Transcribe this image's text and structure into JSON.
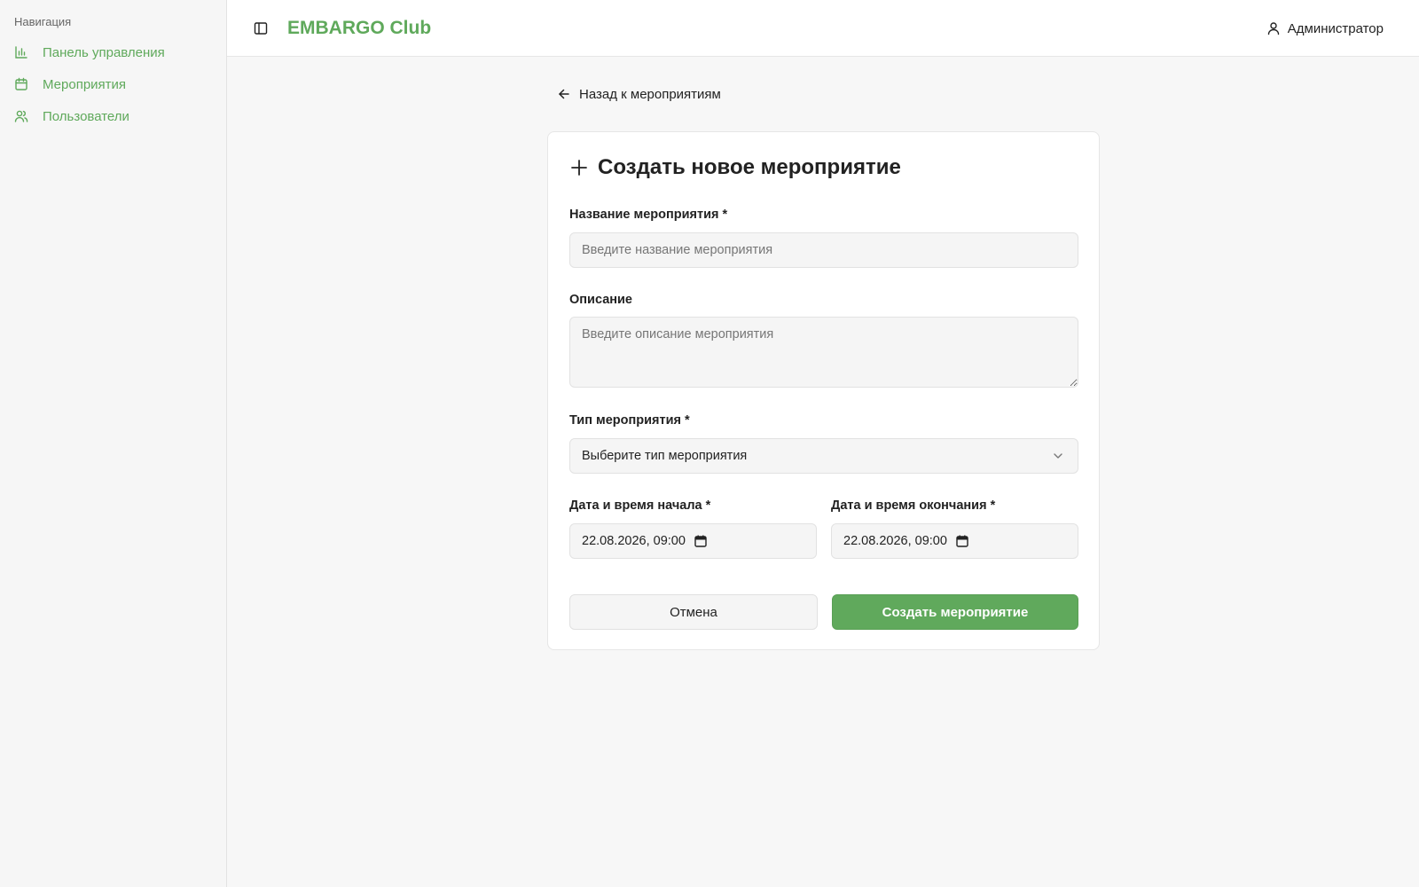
{
  "sidebar": {
    "section_title": "Навигация",
    "items": [
      {
        "label": "Панель управления",
        "icon": "bar-chart-icon"
      },
      {
        "label": "Мероприятия",
        "icon": "calendar-icon"
      },
      {
        "label": "Пользователи",
        "icon": "users-icon"
      }
    ]
  },
  "header": {
    "brand": "EMBARGO Club",
    "user_label": "Администратор"
  },
  "back_link": "Назад к мероприятиям",
  "form": {
    "title": "Создать новое мероприятие",
    "name_label": "Название мероприятия *",
    "name_placeholder": "Введите название мероприятия",
    "description_label": "Описание",
    "description_placeholder": "Введите описание мероприятия",
    "type_label": "Тип мероприятия *",
    "type_value": "Выберите тип мероприятия",
    "start_label": "Дата и время начала *",
    "start_value": "22.08.2026, 09:00",
    "end_label": "Дата и время окончания *",
    "end_value": "22.08.2026, 09:00",
    "cancel_label": "Отмена",
    "submit_label": "Создать мероприятие"
  },
  "colors": {
    "accent": "#5fa95b",
    "primary_button": "#60a95c"
  }
}
